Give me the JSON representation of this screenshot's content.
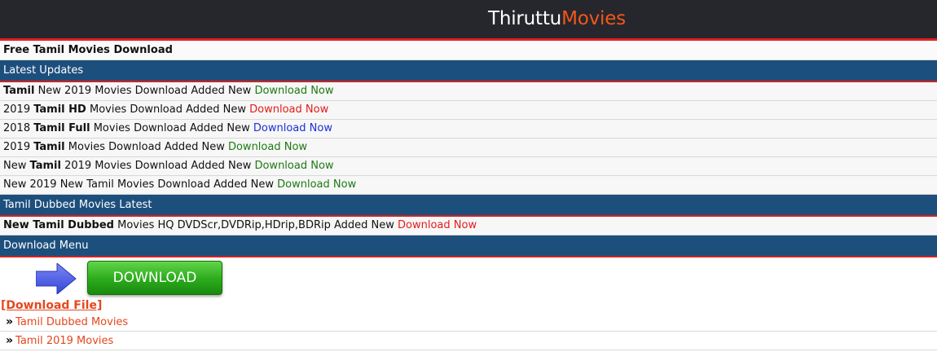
{
  "header": {
    "logo_part1": "Thiruttu",
    "logo_part2": "Movies"
  },
  "intro": "Free Tamil Movies Download",
  "latest": {
    "title": "Latest Updates",
    "rows": [
      {
        "t1": "",
        "b1": "Tamil",
        "t2": " New 2019 Movies Download Added New ",
        "b2": "",
        "t3": "",
        "link": "Download Now",
        "color": "#1c7a12"
      },
      {
        "t1": "2019 ",
        "b1": "Tamil HD",
        "t2": " Movies Download Added New ",
        "b2": "",
        "t3": "",
        "link": "Download Now",
        "color": "#e51b1b"
      },
      {
        "t1": "2018 ",
        "b1": "Tamil Full",
        "t2": " Movies Download Added New ",
        "b2": "",
        "t3": "",
        "link": "Download Now",
        "color": "#1d2fd6"
      },
      {
        "t1": "2019 ",
        "b1": "Tamil",
        "t2": " Movies Download Added New ",
        "b2": "",
        "t3": "",
        "link": "Download Now",
        "color": "#1c7a12"
      },
      {
        "t1": "New ",
        "b1": "Tamil",
        "t2": " 2019 Movies Download Added New ",
        "b2": "",
        "t3": "",
        "link": "Download Now",
        "color": "#1c7a12"
      },
      {
        "t1": "New 2019 New Tamil Movies Download Added New ",
        "b1": "",
        "t2": "",
        "b2": "",
        "t3": "",
        "link": "Download Now",
        "color": "#1c7a12"
      }
    ]
  },
  "dubbed": {
    "title": "Tamil Dubbed Movies Latest",
    "row": {
      "b1": "New Tamil Dubbed",
      "t1": " Movies HQ DVDScr,DVDRip,HDrip,BDRip Added New ",
      "link": "Download Now"
    }
  },
  "download_menu": {
    "title": "Download Menu",
    "button": "DOWNLOAD",
    "file_link": "[Download File]",
    "items": [
      {
        "chev": "»",
        "label": "Tamil Dubbed Movies"
      },
      {
        "chev": "»",
        "label": "Tamil 2019 Movies"
      }
    ]
  },
  "colors": {
    "header_bg": "#26272c",
    "section_bg": "#1d4f7d",
    "accent_red": "#e21f1f",
    "logo_accent": "#f2571b"
  },
  "icons": {
    "arrow": "arrow-right-icon",
    "chevron": "double-chevron-right-icon"
  }
}
